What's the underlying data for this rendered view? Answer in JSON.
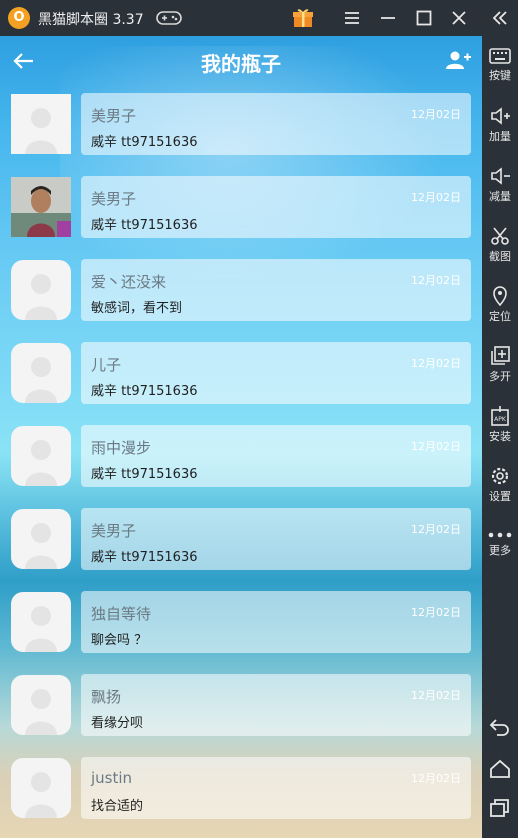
{
  "emulator": {
    "title": "黑猫脚本圈 3.37",
    "logo_glyph": "O",
    "sidebar": [
      {
        "label": "按键",
        "icon": "keyboard-icon"
      },
      {
        "label": "加量",
        "icon": "volume-up-icon"
      },
      {
        "label": "减量",
        "icon": "volume-down-icon"
      },
      {
        "label": "截图",
        "icon": "scissors-icon"
      },
      {
        "label": "定位",
        "icon": "location-icon"
      },
      {
        "label": "多开",
        "icon": "multi-open-icon"
      },
      {
        "label": "安装",
        "icon": "apk-install-icon"
      },
      {
        "label": "设置",
        "icon": "gear-icon"
      },
      {
        "label": "更多",
        "icon": "more-dots-icon"
      }
    ]
  },
  "app": {
    "title": "我的瓶子",
    "items": [
      {
        "name": "美男子",
        "date": "12月02日",
        "message": "威辛 tt97151636",
        "avatar": "default-square"
      },
      {
        "name": "美男子",
        "date": "12月02日",
        "message": "威辛 tt97151636",
        "avatar": "photo"
      },
      {
        "name": "爱丶还没来",
        "date": "12月02日",
        "message": "敏感词，看不到",
        "avatar": "default"
      },
      {
        "name": "儿子",
        "date": "12月02日",
        "message": "威辛 tt97151636",
        "avatar": "default"
      },
      {
        "name": "雨中漫步",
        "date": "12月02日",
        "message": "威辛 tt97151636",
        "avatar": "default"
      },
      {
        "name": "美男子",
        "date": "12月02日",
        "message": "威辛 tt97151636",
        "avatar": "default"
      },
      {
        "name": "独自等待",
        "date": "12月02日",
        "message": "聊会吗 ？",
        "avatar": "default"
      },
      {
        "name": "飘扬",
        "date": "12月02日",
        "message": "看缘分呗",
        "avatar": "default"
      },
      {
        "name": "justin",
        "date": "12月02日",
        "message": "找合适的",
        "avatar": "default"
      }
    ]
  },
  "colors": {
    "header_text": "#ffffff",
    "emulator_chrome": "#2b3138",
    "logo": "#f4a123"
  }
}
